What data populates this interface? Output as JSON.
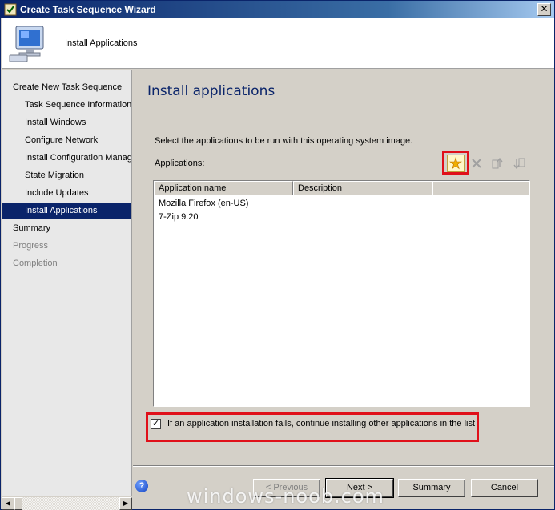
{
  "window": {
    "title": "Create Task Sequence Wizard",
    "close_glyph": "✕"
  },
  "header": {
    "title": "Install Applications",
    "icon": "computer-monitor-icon"
  },
  "nav": {
    "items": [
      {
        "label": "Create New Task Sequence",
        "level": "top",
        "state": "normal"
      },
      {
        "label": "Task Sequence Information",
        "level": "sub",
        "state": "normal"
      },
      {
        "label": "Install Windows",
        "level": "sub",
        "state": "normal"
      },
      {
        "label": "Configure Network",
        "level": "sub",
        "state": "normal"
      },
      {
        "label": "Install Configuration Manag",
        "level": "sub",
        "state": "normal"
      },
      {
        "label": "State Migration",
        "level": "sub",
        "state": "normal"
      },
      {
        "label": "Include Updates",
        "level": "sub",
        "state": "normal"
      },
      {
        "label": "Install Applications",
        "level": "sub",
        "state": "active"
      },
      {
        "label": "Summary",
        "level": "top",
        "state": "normal"
      },
      {
        "label": "Progress",
        "level": "top",
        "state": "disabled"
      },
      {
        "label": "Completion",
        "level": "top",
        "state": "disabled"
      }
    ]
  },
  "main": {
    "page_title": "Install applications",
    "instructions": "Select the applications to be run with this operating system image.",
    "apps_label": "Applications:",
    "toolbar": {
      "new_icon": "new-item-star-icon",
      "delete_icon": "delete-x-icon",
      "move_up_icon": "move-up-icon",
      "move_down_icon": "move-down-icon"
    },
    "table": {
      "columns": [
        "Application name",
        "Description"
      ],
      "rows": [
        {
          "name": "Mozilla Firefox (en-US)",
          "description": ""
        },
        {
          "name": "7-Zip 9.20",
          "description": ""
        }
      ]
    },
    "continue_on_error": {
      "checked": true,
      "label": "If an application installation fails, continue installing other applications in the list"
    }
  },
  "footer": {
    "previous": "< Previous",
    "next": "Next >",
    "summary": "Summary",
    "cancel": "Cancel"
  },
  "watermark": "windows-noob.com",
  "colors": {
    "highlight_box": "#e0101a",
    "active_nav": "#0a246a",
    "title_text": "#0a246a"
  }
}
